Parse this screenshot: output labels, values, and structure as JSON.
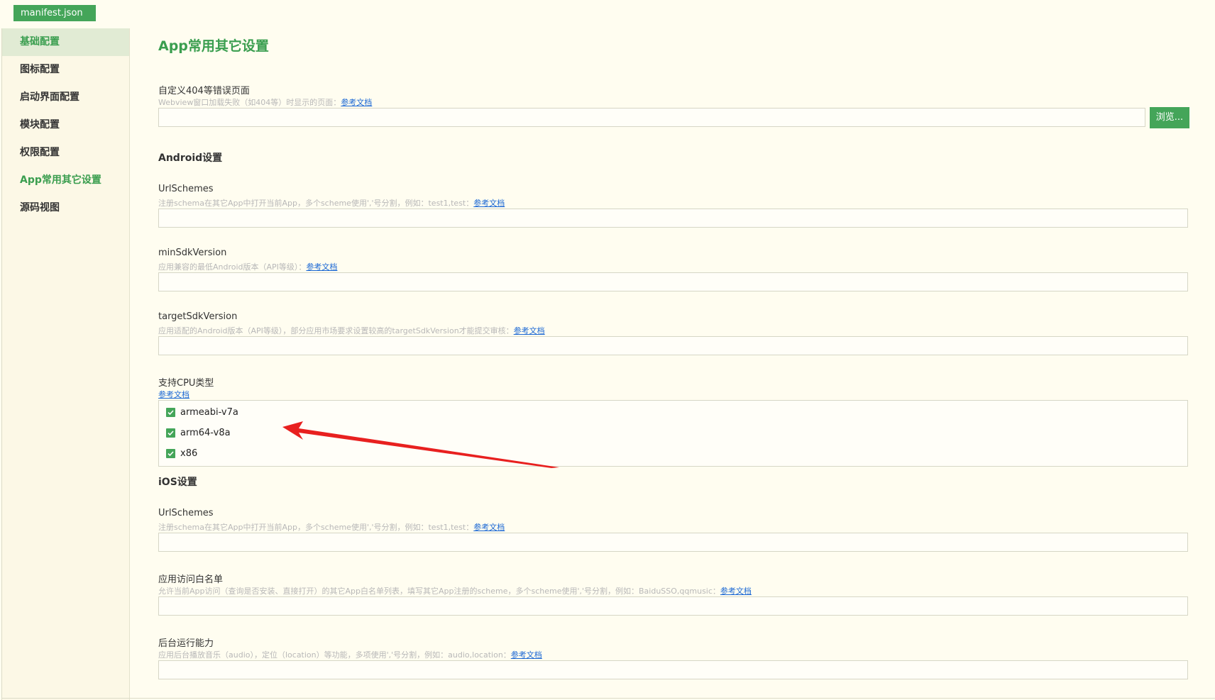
{
  "file_tab": {
    "label": "manifest.json"
  },
  "sidebar": {
    "items": [
      {
        "label": "基础配置"
      },
      {
        "label": "图标配置"
      },
      {
        "label": "启动界面配置"
      },
      {
        "label": "模块配置"
      },
      {
        "label": "权限配置"
      },
      {
        "label": "App常用其它设置"
      },
      {
        "label": "源码视图"
      }
    ]
  },
  "page": {
    "title": "App常用其它设置"
  },
  "error_page": {
    "label": "自定义404等错误页面",
    "desc": "Webview窗口加载失败（如404等）时显示的页面：",
    "link": "参考文档",
    "value": "",
    "browse_label": "浏览..."
  },
  "android": {
    "title": "Android设置",
    "url_schemes": {
      "label": "UrlSchemes",
      "desc": "注册schema在其它App中打开当前App，多个scheme使用','号分割，例如：test1,test：",
      "link": "参考文档",
      "value": ""
    },
    "min_sdk": {
      "label": "minSdkVersion",
      "desc": "应用兼容的最低Android版本（API等级）：",
      "link": "参考文档",
      "value": ""
    },
    "target_sdk": {
      "label": "targetSdkVersion",
      "desc": "应用适配的Android版本（API等级），部分应用市场要求设置较高的targetSdkVersion才能提交审核：",
      "link": "参考文档",
      "value": ""
    },
    "cpu": {
      "label": "支持CPU类型",
      "link": "参考文档",
      "options": [
        {
          "label": "armeabi-v7a",
          "checked": true
        },
        {
          "label": "arm64-v8a",
          "checked": true
        },
        {
          "label": "x86",
          "checked": true
        }
      ]
    }
  },
  "ios": {
    "title": "iOS设置",
    "url_schemes": {
      "label": "UrlSchemes",
      "desc": "注册schema在其它App中打开当前App，多个scheme使用','号分割，例如：test1,test：",
      "link": "参考文档",
      "value": ""
    },
    "whitelist": {
      "label": "应用访问白名单",
      "desc": "允许当前App访问（查询是否安装、直接打开）的其它App白名单列表，填写其它App注册的scheme，多个scheme使用','号分割，例如：BaiduSSO,qqmusic：",
      "link": "参考文档",
      "value": ""
    },
    "background": {
      "label": "后台运行能力",
      "desc": "应用后台播放音乐（audio），定位（location）等功能，多项使用','号分割，例如：audio,location：",
      "link": "参考文档",
      "value": ""
    }
  },
  "colors": {
    "accent": "#44a559",
    "annotation_arrow": "#e8201f"
  }
}
